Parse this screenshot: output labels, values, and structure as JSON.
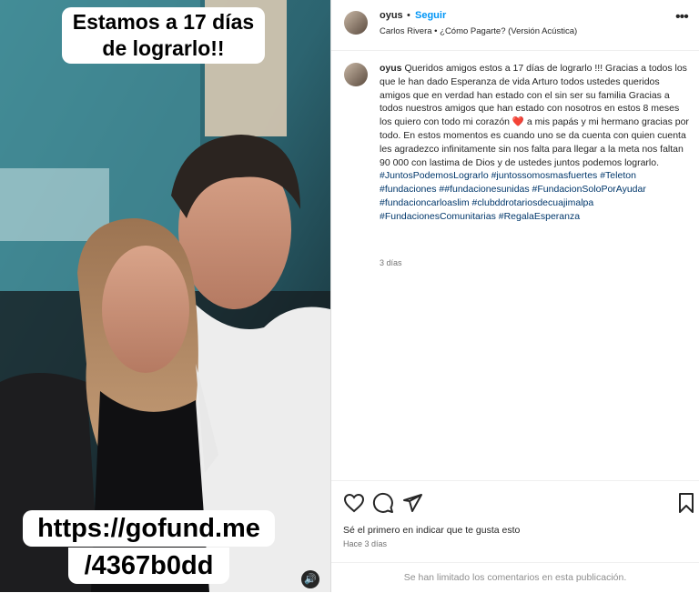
{
  "media": {
    "overlay_line1": "Estamos a 17 días",
    "overlay_line2": "de lograrlo!!",
    "link_line1": "https://gofund.me",
    "link_line2": "/4367b0dd"
  },
  "header": {
    "username": "oyus",
    "separator": "•",
    "follow_label": "Seguir",
    "song": "Carlos Rivera • ¿Cómo Pagarte? (Versión Acústica)",
    "more_icon": "more-horizontal-icon"
  },
  "caption": {
    "username": "oyus",
    "text_part1": "Queridos amigos estos a 17 días de lograrlo !!! Gracias a todos los que le han dado Esperanza de vida Arturo todos ustedes queridos amigos que en verdad han estado con el sin ser su familia Gracias a todos nuestros amigos que han estado con nosotros en estos 8 meses los quiero con todo mi corazón",
    "heart_emoji": "❤️",
    "text_part2": "a mis papás y mi hermano gracias por todo. En estos momentos es cuando uno se da cuenta con quien cuenta les agradezco infinitamente sin nos falta para llegar a la meta nos faltan 90 000 con lastima de Dios y de ustedes juntos podemos lograrlo.",
    "hashtags": "#JuntosPodemosLograrlo #juntossomosmasfuertes #Teleton #fundaciones ##fundacionesunidas #FundacionSoloPorAyudar #fundacioncarloaslim #clubddrotariosdecuajimalpa #FundacionesComunitarias #RegalaEsperanza",
    "time_ago": "3 días"
  },
  "actions": {
    "like_icon": "heart-icon",
    "comment_icon": "comment-icon",
    "share_icon": "share-icon",
    "save_icon": "bookmark-icon",
    "likes_text": "Sé el primero en indicar que te gusta esto",
    "date_text": "Hace 3 días"
  },
  "footer": {
    "comments_limited": "Se han limitado los comentarios en esta publicación."
  },
  "colors": {
    "link_blue": "#0095f6",
    "hashtag_blue": "#00376b",
    "heart_red": "#ed4956"
  }
}
